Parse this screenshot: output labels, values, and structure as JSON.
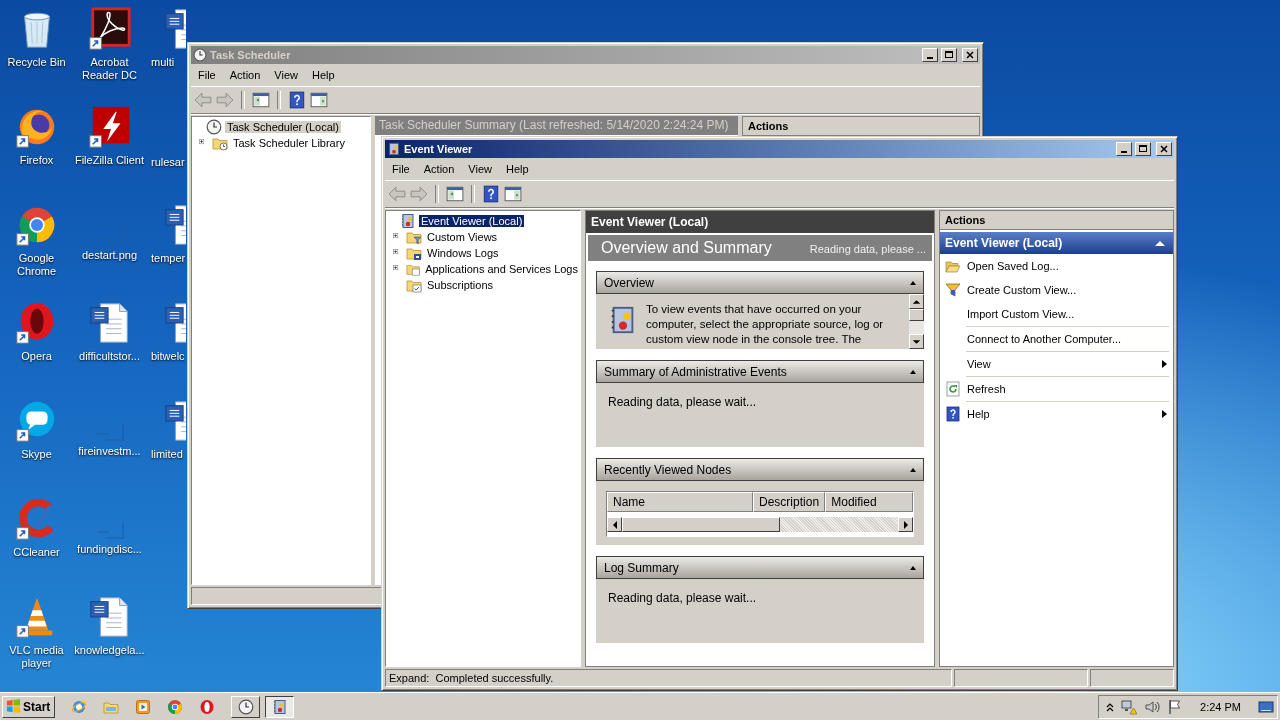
{
  "desktop": {
    "icons": [
      {
        "label": "Recycle Bin",
        "kind": "recycle",
        "shortcut": false
      },
      {
        "label": "Firefox",
        "kind": "firefox",
        "shortcut": true
      },
      {
        "label": "Google Chrome",
        "kind": "chrome",
        "shortcut": true
      },
      {
        "label": "Opera",
        "kind": "opera",
        "shortcut": true
      },
      {
        "label": "Skype",
        "kind": "skype",
        "shortcut": true
      },
      {
        "label": "CCleaner",
        "kind": "ccleaner",
        "shortcut": true
      },
      {
        "label": "VLC media player",
        "kind": "vlc",
        "shortcut": true
      },
      {
        "label": "Acrobat Reader DC",
        "kind": "acrobat",
        "shortcut": true
      },
      {
        "label": "FileZilla Client",
        "kind": "filezilla",
        "shortcut": true
      },
      {
        "label": "destart.png",
        "kind": "image",
        "shortcut": false
      },
      {
        "label": "difficultstor...",
        "kind": "word",
        "shortcut": false
      },
      {
        "label": "fireinvestm...",
        "kind": "image",
        "shortcut": false
      },
      {
        "label": "fundingdisc...",
        "kind": "image",
        "shortcut": false
      },
      {
        "label": "knowledgela...",
        "kind": "word",
        "shortcut": false
      },
      {
        "label": "multi",
        "kind": "word",
        "shortcut": false
      },
      {
        "label": "rulesar",
        "kind": "blank",
        "shortcut": false
      },
      {
        "label": "temper",
        "kind": "word",
        "shortcut": false
      },
      {
        "label": "bitwelc",
        "kind": "word",
        "shortcut": false
      },
      {
        "label": "limited",
        "kind": "word",
        "shortcut": false
      }
    ]
  },
  "task_scheduler_window": {
    "title": "Task Scheduler",
    "active": false,
    "menu": [
      "File",
      "Action",
      "View",
      "Help"
    ],
    "tree": [
      {
        "label": "Task Scheduler (Local)",
        "kind": "clock",
        "selected": true,
        "expandable": false,
        "children": [
          {
            "label": "Task Scheduler Library",
            "kind": "folder-clock",
            "selected": false,
            "expandable": true
          }
        ]
      }
    ],
    "center_header": "Task Scheduler Summary (Last refreshed: 5/14/2020 2:24:24 PM)",
    "actions_header": "Actions"
  },
  "event_viewer_window": {
    "title": "Event Viewer",
    "active": true,
    "menu": [
      "File",
      "Action",
      "View",
      "Help"
    ],
    "tree": [
      {
        "label": "Event Viewer (Local)",
        "kind": "eventviewer",
        "selected": true,
        "expandable": false,
        "children": [
          {
            "label": "Custom Views",
            "kind": "folder-filter",
            "selected": false,
            "expandable": true
          },
          {
            "label": "Windows Logs",
            "kind": "folder-logs",
            "selected": false,
            "expandable": true
          },
          {
            "label": "Applications and Services Logs",
            "kind": "folder-apps",
            "selected": false,
            "expandable": true
          },
          {
            "label": "Subscriptions",
            "kind": "folder-subs",
            "selected": false,
            "expandable": false
          }
        ]
      }
    ],
    "center": {
      "header": "Event Viewer (Local)",
      "title": "Overview and Summary",
      "status": "Reading data, please ...",
      "sections": [
        {
          "title": "Overview",
          "expanded": true,
          "kind": "text",
          "text": "To view events that have occurred on your computer, select the appropriate source, log or custom view node in the console tree. The"
        },
        {
          "title": "Summary of Administrative Events",
          "expanded": true,
          "kind": "message",
          "text": "Reading data, please wait..."
        },
        {
          "title": "Recently Viewed Nodes",
          "expanded": true,
          "kind": "table",
          "columns": [
            "Name",
            "Description",
            "Modified"
          ]
        },
        {
          "title": "Log Summary",
          "expanded": true,
          "kind": "message",
          "text": "Reading data, please wait..."
        }
      ]
    },
    "actions": {
      "header": "Actions",
      "group": "Event Viewer (Local)",
      "expanded": true,
      "items": [
        {
          "label": "Open Saved Log...",
          "kind": "open",
          "submenu": false,
          "divider_before": false
        },
        {
          "label": "Create Custom View...",
          "kind": "filter",
          "submenu": false,
          "divider_before": false
        },
        {
          "label": "Import Custom View...",
          "kind": "none",
          "submenu": false,
          "divider_before": false
        },
        {
          "label": "Connect to Another Computer...",
          "kind": "none",
          "submenu": false,
          "divider_before": true
        },
        {
          "label": "View",
          "kind": "none",
          "submenu": true,
          "divider_before": true
        },
        {
          "label": "Refresh",
          "kind": "refresh",
          "submenu": false,
          "divider_before": true
        },
        {
          "label": "Help",
          "kind": "help",
          "submenu": true,
          "divider_before": true
        }
      ]
    },
    "status_bar": {
      "text": "Expand:  Completed successfully."
    }
  },
  "taskbar": {
    "start": "Start",
    "quick_launch": [
      {
        "kind": "ie"
      },
      {
        "kind": "explorer"
      },
      {
        "kind": "media"
      },
      {
        "kind": "chrome"
      },
      {
        "kind": "opera"
      }
    ],
    "tasks": [
      {
        "kind": "clock",
        "selected": false
      },
      {
        "kind": "eventviewer",
        "selected": true
      }
    ],
    "clock": "2:24 PM"
  }
}
